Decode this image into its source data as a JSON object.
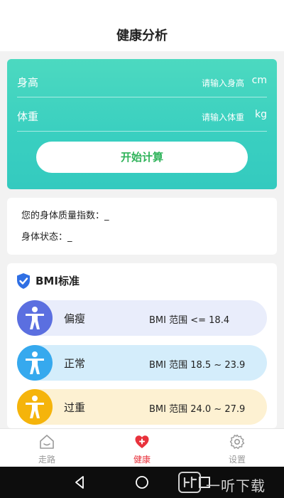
{
  "header": {
    "title": "健康分析"
  },
  "calculator": {
    "height": {
      "label": "身高",
      "placeholder": "请输入身高",
      "unit": "cm"
    },
    "weight": {
      "label": "体重",
      "placeholder": "请输入体重",
      "unit": "kg"
    },
    "button_label": "开始计算"
  },
  "result": {
    "bmi_label": "您的身体质量指数：",
    "bmi_value": "_",
    "status_label": "身体状态：",
    "status_value": "_"
  },
  "standard": {
    "title": "BMI标准",
    "items": [
      {
        "name": "偏瘦",
        "range": "BMI 范围 <= 18.4",
        "bg": "#e9edfb",
        "avatar": "#5b6fe0"
      },
      {
        "name": "正常",
        "range": "BMI 范围 18.5 ~ 23.9",
        "bg": "#d4edfb",
        "avatar": "#36a9ee"
      },
      {
        "name": "过重",
        "range": "BMI 范围 24.0 ~ 27.9",
        "bg": "#fdf1d2",
        "avatar": "#f5b40b"
      }
    ]
  },
  "tabs": [
    {
      "label": "走路",
      "icon": "house-icon"
    },
    {
      "label": "健康",
      "icon": "heart-plus-icon"
    },
    {
      "label": "设置",
      "icon": "gear-icon"
    }
  ],
  "watermark": {
    "text": "一听下载"
  },
  "colors": {
    "accent": "#36cfbf",
    "button_text": "#2fb35a",
    "active_tab": "#e8323c",
    "shield": "#2f6fe4"
  }
}
